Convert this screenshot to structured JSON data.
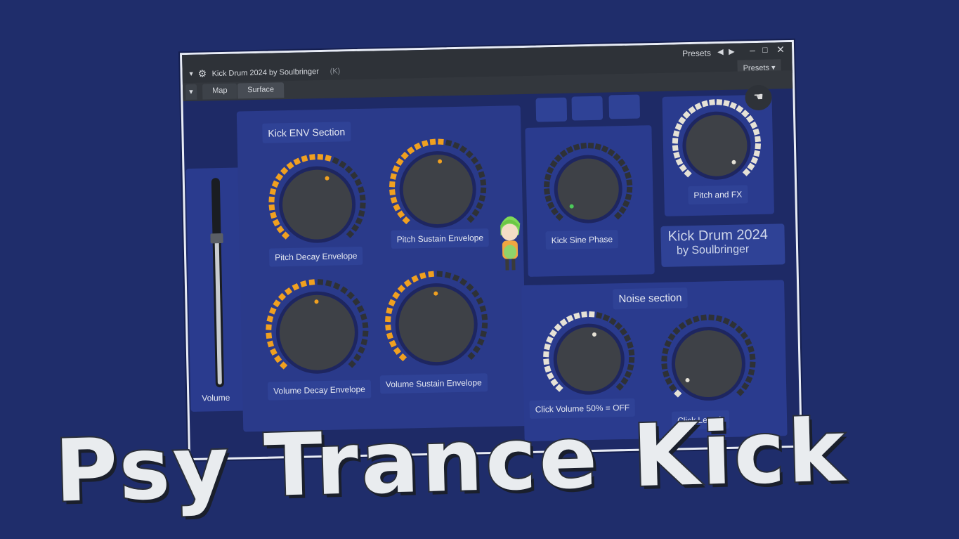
{
  "window": {
    "title": "Kick Drum 2024 by Soulbringer",
    "title_suffix": "(K)",
    "presets_label": "Presets",
    "presets_dropdown": "Presets",
    "tabs": [
      {
        "label": "Map"
      },
      {
        "label": "Surface"
      }
    ]
  },
  "plugin": {
    "kick_env_title": "Kick ENV Section",
    "noise_title": "Noise section",
    "brand_line1": "Kick Drum 2024",
    "brand_line2": "by Soulbringer",
    "volume_label": "Volume",
    "volume_level": 0.72,
    "knobs": [
      {
        "id": "pitch-decay",
        "label": "Pitch Decay Envelope",
        "level": 0.58,
        "color": "#f0a020"
      },
      {
        "id": "pitch-sustain",
        "label": "Pitch Sustain Envelope",
        "level": 0.52,
        "color": "#f0a020"
      },
      {
        "id": "volume-decay",
        "label": "Volume Decay Envelope",
        "level": 0.5,
        "color": "#f0a020"
      },
      {
        "id": "volume-sustain",
        "label": "Volume Sustain Envelope",
        "level": 0.5,
        "color": "#f0a020"
      },
      {
        "id": "kick-sine-phase",
        "label": "Kick Sine Phase",
        "level": 0.0,
        "color": "#4cc95a"
      },
      {
        "id": "pitch-fx",
        "label": "Pitch and FX",
        "level": 1.0,
        "color": "#e6e2d6"
      },
      {
        "id": "click-volume",
        "label": "Click Volume 50% = OFF",
        "level": 0.55,
        "color": "#e6e2d6"
      },
      {
        "id": "click-length",
        "label": "Click Length",
        "level": 0.03,
        "color": "#e6e2d6"
      }
    ]
  },
  "overlay_title": "Psy Trance Kick",
  "colors": {
    "background": "#1f2d6b",
    "panel": "#2a3b8e",
    "knob": "#3e4147",
    "ring_off": "#2e3136"
  }
}
